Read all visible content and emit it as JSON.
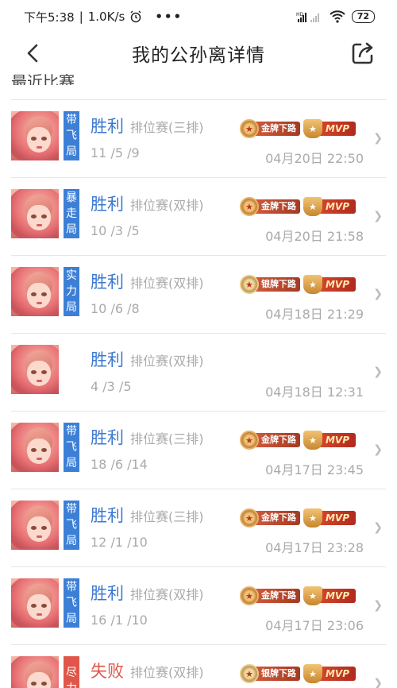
{
  "status": {
    "time": "下午5:38",
    "speed": "1.0K/s",
    "battery": "72",
    "network": "HD"
  },
  "nav": {
    "title": "我的公孙离详情"
  },
  "section": {
    "header": "最近比赛"
  },
  "icons": [
    "alarm-icon",
    "more-dots-icon",
    "signal-icon",
    "wifi-icon",
    "back-icon",
    "share-icon",
    "chevron-right-icon",
    "medal-icon",
    "trophy-icon"
  ],
  "colors": {
    "win": "#3b78d0",
    "loss": "#e0564a",
    "tag_blue": "#3c7fd6",
    "tag_red": "#e0564a"
  },
  "matches": [
    {
      "tag": [
        "带",
        "飞",
        "局"
      ],
      "tag_color": "blue",
      "result": "胜利",
      "is_win": true,
      "mode": "排位赛(三排)",
      "kda": "11 /5 /9",
      "datetime": "04月20日 22:50",
      "badge": "金牌下路",
      "badge_kind": "gold",
      "mvp": "MVP"
    },
    {
      "tag": [
        "暴",
        "走",
        "局"
      ],
      "tag_color": "blue",
      "result": "胜利",
      "is_win": true,
      "mode": "排位赛(双排)",
      "kda": "10 /3 /5",
      "datetime": "04月20日 21:58",
      "badge": "金牌下路",
      "badge_kind": "gold",
      "mvp": "MVP"
    },
    {
      "tag": [
        "实",
        "力",
        "局"
      ],
      "tag_color": "blue",
      "result": "胜利",
      "is_win": true,
      "mode": "排位赛(双排)",
      "kda": "10 /6 /8",
      "datetime": "04月18日 21:29",
      "badge": "银牌下路",
      "badge_kind": "silver",
      "mvp": "MVP"
    },
    {
      "tag": [],
      "tag_color": "",
      "result": "胜利",
      "is_win": true,
      "mode": "排位赛(双排)",
      "kda": "4 /3 /5",
      "datetime": "04月18日 12:31",
      "badge": "",
      "badge_kind": "",
      "mvp": ""
    },
    {
      "tag": [
        "带",
        "飞",
        "局"
      ],
      "tag_color": "blue",
      "result": "胜利",
      "is_win": true,
      "mode": "排位赛(三排)",
      "kda": "18 /6 /14",
      "datetime": "04月17日 23:45",
      "badge": "金牌下路",
      "badge_kind": "gold",
      "mvp": "MVP"
    },
    {
      "tag": [
        "带",
        "飞",
        "局"
      ],
      "tag_color": "blue",
      "result": "胜利",
      "is_win": true,
      "mode": "排位赛(三排)",
      "kda": "12 /1 /10",
      "datetime": "04月17日 23:28",
      "badge": "金牌下路",
      "badge_kind": "gold",
      "mvp": "MVP"
    },
    {
      "tag": [
        "带",
        "飞",
        "局"
      ],
      "tag_color": "blue",
      "result": "胜利",
      "is_win": true,
      "mode": "排位赛(双排)",
      "kda": "16 /1 /10",
      "datetime": "04月17日 23:06",
      "badge": "金牌下路",
      "badge_kind": "gold",
      "mvp": "MVP"
    },
    {
      "tag": [
        "尽",
        "力"
      ],
      "tag_color": "red",
      "result": "失败",
      "is_win": false,
      "mode": "排位赛(双排)",
      "kda": "",
      "datetime": "",
      "badge": "银牌下路",
      "badge_kind": "silver",
      "mvp": "MVP"
    }
  ]
}
